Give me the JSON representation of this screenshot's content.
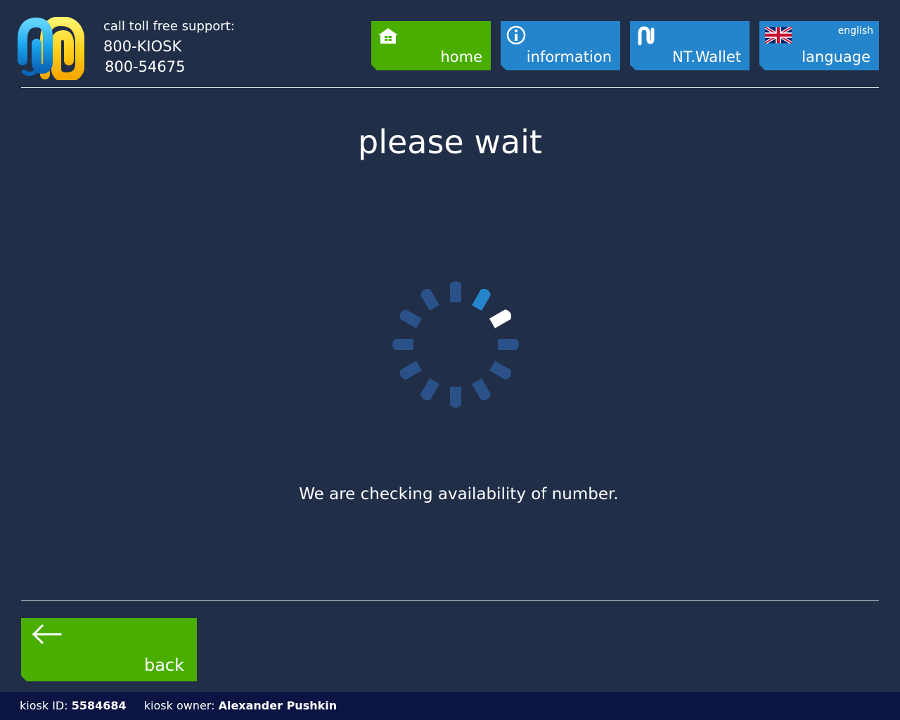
{
  "header": {
    "logo_icon": "kiosk-logo-icon",
    "support_label": "call toll free support:",
    "phone_primary": "800-KIOSK",
    "phone_secondary": "800-54675"
  },
  "nav": {
    "home": {
      "label": "home",
      "icon": "home-icon"
    },
    "information": {
      "label": "information",
      "icon": "info-icon"
    },
    "wallet": {
      "label": "NT.Wallet",
      "icon": "wallet-logo-icon"
    },
    "language": {
      "label": "language",
      "current": "english",
      "icon": "uk-flag-icon"
    }
  },
  "main": {
    "title": "please wait",
    "spinner_icon": "loading-spinner-icon",
    "message": "We are checking availability of number."
  },
  "back": {
    "label": "back",
    "icon": "arrow-left-icon"
  },
  "footer": {
    "kiosk_id_label": "kiosk ID:",
    "kiosk_id": "5584684",
    "owner_label": "kiosk owner:",
    "owner": "Alexander Pushkin"
  },
  "colors": {
    "background": "#212e47",
    "green": "#4aae00",
    "blue": "#2585cc",
    "footer": "#0b1442",
    "spinner_dim": "#2a5288",
    "spinner_mid": "#2585cc",
    "spinner_active": "#ffffff"
  }
}
